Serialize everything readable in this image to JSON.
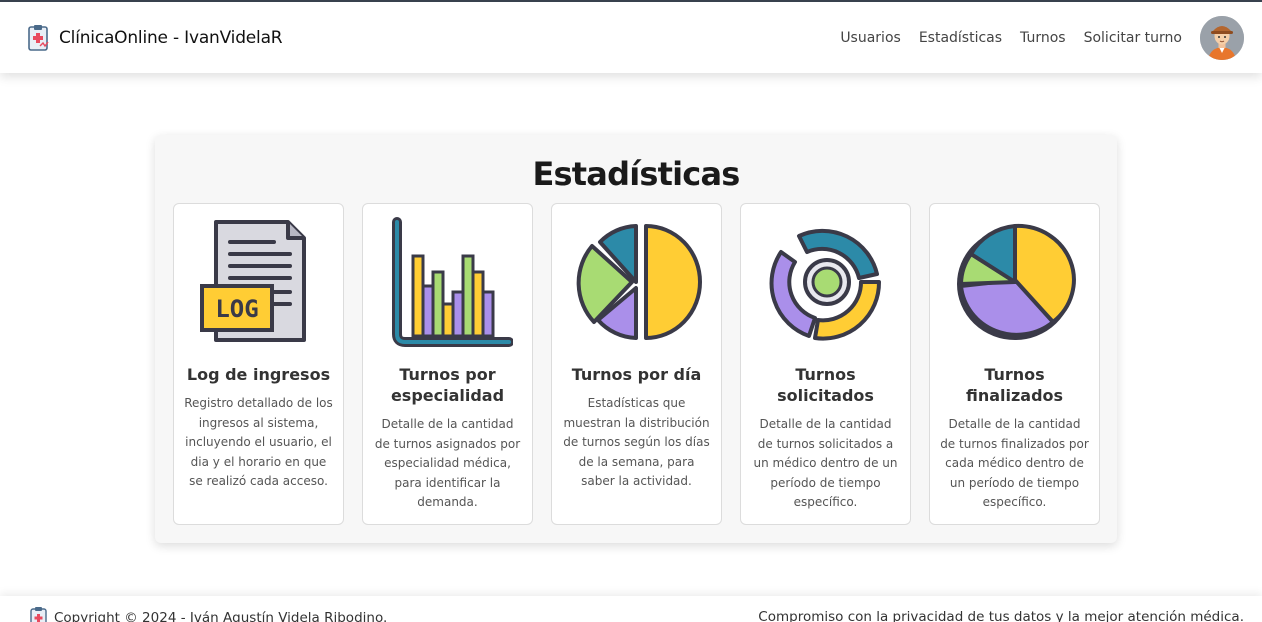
{
  "navbar": {
    "brand": "ClínicaOnline - IvanVidelaR",
    "links": [
      "Usuarios",
      "Estadísticas",
      "Turnos",
      "Solicitar turno"
    ]
  },
  "main": {
    "title": "Estadísticas",
    "cards": [
      {
        "title": "Log de ingresos",
        "description": "Registro detallado de los ingresos al sistema, incluyendo el usuario, el dia y el horario en que se realizó cada acceso.",
        "icon": "log-file-icon"
      },
      {
        "title": "Turnos por especialidad",
        "description": "Detalle de la cantidad de turnos asignados por especialidad médica, para identificar la demanda.",
        "icon": "bar-chart-icon"
      },
      {
        "title": "Turnos por día",
        "description": "Estadísticas que muestran la distribución de turnos según los días de la semana, para saber la actividad.",
        "icon": "pie-chart-icon"
      },
      {
        "title": "Turnos solicitados",
        "description": "Detalle de la cantidad de turnos solicitados a un médico dentro de un período de tiempo específico.",
        "icon": "donut-chart-icon"
      },
      {
        "title": "Turnos finalizados",
        "description": "Detalle de la cantidad de turnos finalizados por cada médico dentro de un período de tiempo específico.",
        "icon": "pie-chart-3d-icon"
      }
    ]
  },
  "footer": {
    "copyright": "Copyright © 2024 - Iván Agustín Videla Ribodino.",
    "tagline": "Compromiso con la privacidad de tus datos y la mejor atención médica."
  },
  "colors": {
    "yellow": "#FFCD34",
    "purple": "#AA8FEA",
    "green": "#A8DB73",
    "teal": "#2C8AA8",
    "outline": "#3A3A48"
  }
}
